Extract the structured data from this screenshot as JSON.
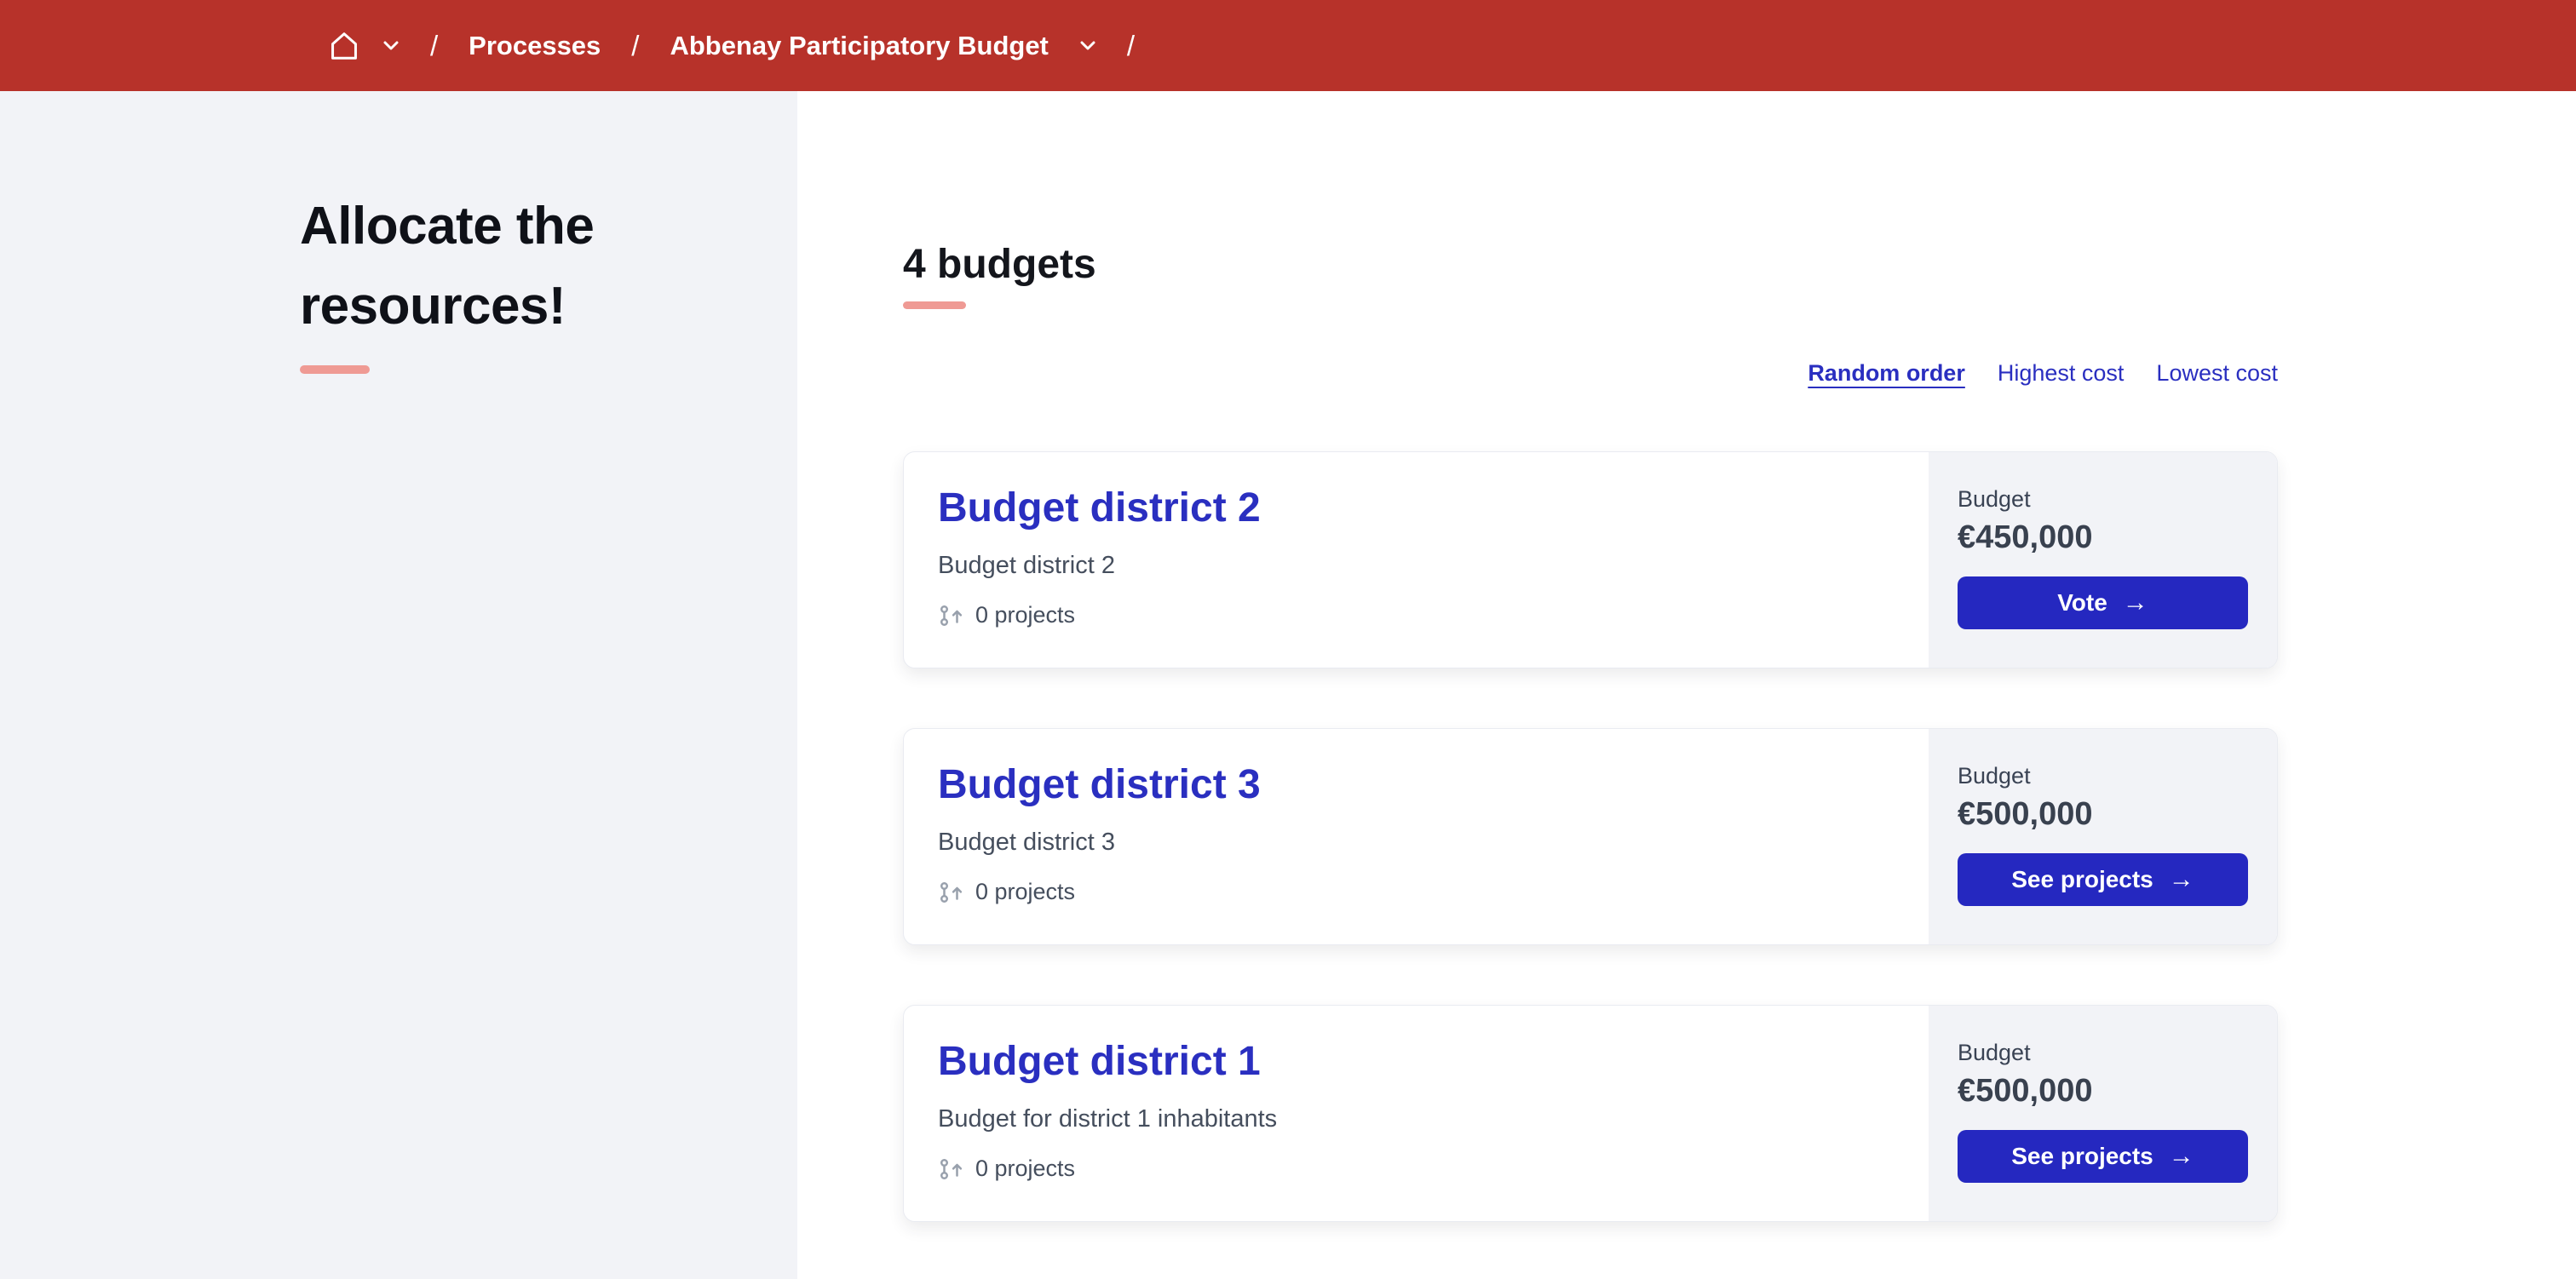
{
  "theme": {
    "header_bg": "#b7322a",
    "accent_salmon": "#ef9a94",
    "link_blue": "#2a2fc0",
    "button_blue": "#2528c0",
    "panel_gray": "#f2f3f7",
    "text_slate": "#454e5d"
  },
  "icons": {
    "arrow_right": "→"
  },
  "breadcrumb": {
    "separator": "/",
    "items": [
      {
        "label": "Processes"
      },
      {
        "label": "Abbenay Participatory Budget"
      }
    ]
  },
  "sidebar": {
    "title": "Allocate the resources!"
  },
  "main": {
    "heading": "4 budgets",
    "sort_options": [
      {
        "label": "Random order",
        "active": true
      },
      {
        "label": "Highest cost",
        "active": false
      },
      {
        "label": "Lowest cost",
        "active": false
      }
    ],
    "budgets": [
      {
        "title": "Budget district 2",
        "description": "Budget district 2",
        "projects": "0 projects",
        "budget_label": "Budget",
        "amount": "€450,000",
        "button": "Vote"
      },
      {
        "title": "Budget district 3",
        "description": "Budget district 3",
        "projects": "0 projects",
        "budget_label": "Budget",
        "amount": "€500,000",
        "button": "See projects"
      },
      {
        "title": "Budget district 1",
        "description": "Budget for district 1 inhabitants",
        "projects": "0 projects",
        "budget_label": "Budget",
        "amount": "€500,000",
        "button": "See projects"
      }
    ]
  }
}
